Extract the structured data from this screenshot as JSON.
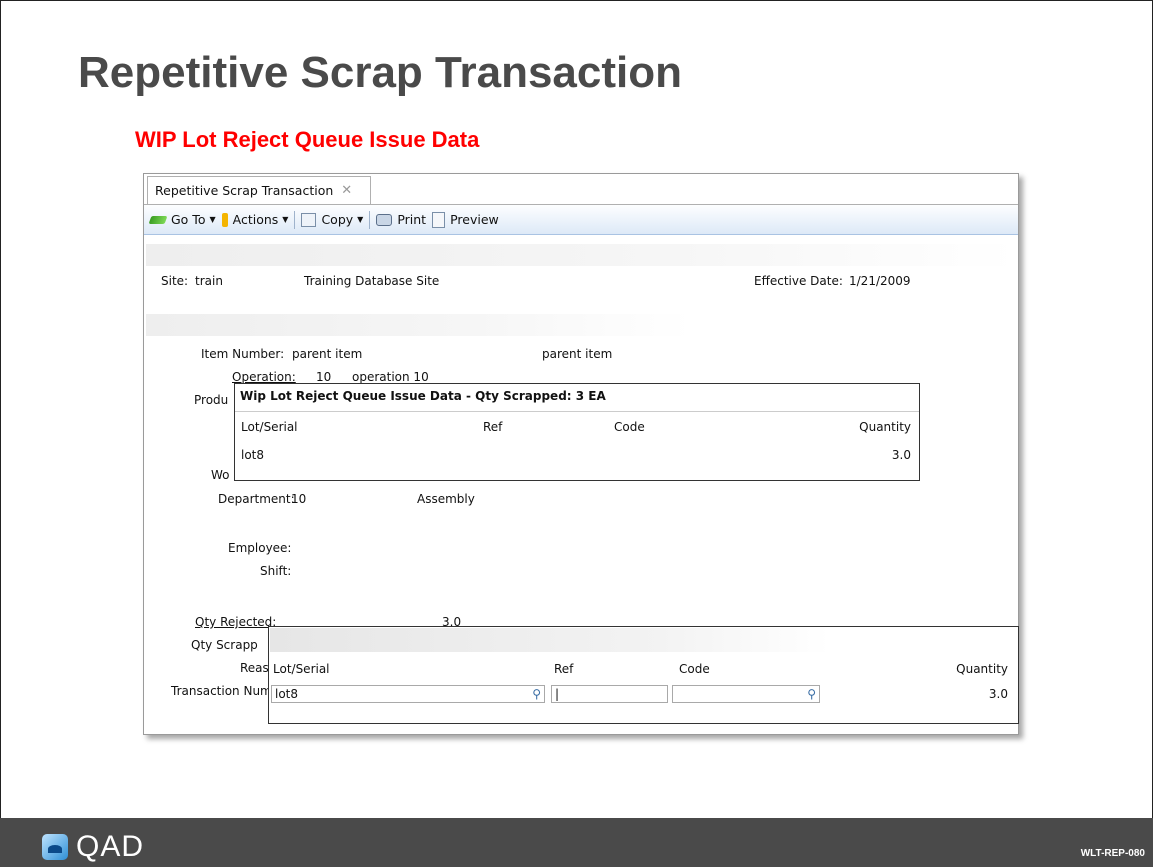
{
  "slide": {
    "title": "Repetitive Scrap Transaction",
    "subtitle": "WIP Lot Reject Queue Issue Data",
    "code": "WLT-REP-080",
    "logo_text": "QAD"
  },
  "window": {
    "tab_label": "Repetitive Scrap Transaction",
    "close_glyph": "✕",
    "toolbar": {
      "goto": "Go To",
      "actions": "Actions",
      "copy": "Copy",
      "print": "Print",
      "preview": "Preview"
    }
  },
  "form": {
    "site_label": "Site:",
    "site_value": "train",
    "site_desc": "Training Database Site",
    "effective_label": "Effective Date:",
    "effective_value": "1/21/2009",
    "item_label": "Item Number:",
    "item_value": "parent item",
    "item_desc": "parent item",
    "operation_label": "Operation:",
    "operation_value": "10",
    "operation_desc": "operation 10",
    "produ_partial": "Produ",
    "wc_partial": "Wo",
    "department_label": "Department:",
    "department_value": "10",
    "department_desc": "Assembly",
    "employee_label": "Employee:",
    "shift_label": "Shift:",
    "qty_rejected_label": "Qty Rejected:",
    "qty_rejected_value": "3.0",
    "qty_scrapped_partial": "Qty Scrapp",
    "reason_partial": "Reas",
    "transaction_partial": "Transaction Numl"
  },
  "popup1": {
    "title": "Wip Lot Reject Queue Issue Data - Qty Scrapped: 3 EA",
    "headers": {
      "lot": "Lot/Serial",
      "ref": "Ref",
      "code": "Code",
      "qty": "Quantity"
    },
    "row": {
      "lot": "lot8",
      "qty": "3.0"
    }
  },
  "popup2": {
    "headers": {
      "lot": "Lot/Serial",
      "ref": "Ref",
      "code": "Code",
      "qty": "Quantity"
    },
    "row": {
      "lot": "lot8",
      "ref": "|",
      "code": "",
      "qty": "3.0"
    }
  },
  "icons": {
    "search": "⚲"
  }
}
